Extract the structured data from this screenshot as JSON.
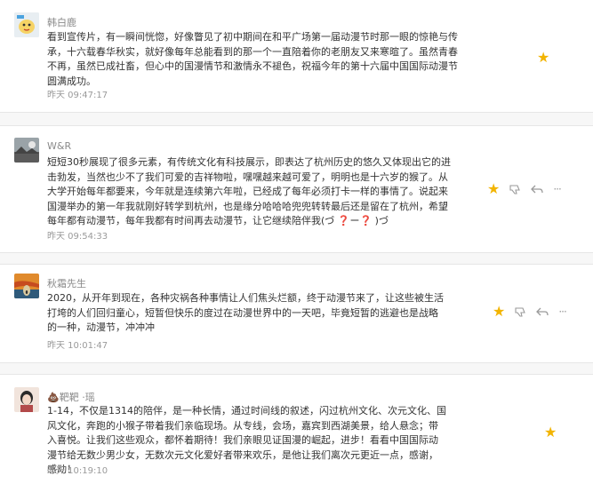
{
  "comments": [
    {
      "username": "韩白鹿",
      "text": "看到宣传片，有一瞬间恍惚，好像瞥见了初中期间在和平广场第一届动漫节时那一眼的惊艳与传承，十六载春华秋实，就好像每年总能看到的那一个一直陪着你的老朋友又来寒暄了。虽然青春不再，虽然已成社畜，但心中的国漫情节和激情永不褪色，祝福今年的第十六届中国国际动漫节圆满成功。",
      "time": "昨天 09:47:17",
      "avatar_icon": "bird-sticker-avatar"
    },
    {
      "username": "W&R",
      "text": "短短30秒展现了很多元素，有传统文化有科技展示，即表达了杭州历史的悠久又体现出它的进击勃发，当然也少不了我们可爱的吉祥物啦，嘿嘿越来越可爱了，明明也是十六岁的猴了。从大学开始每年都要来，今年就是连续第六年啦，已经成了每年必须打卡一样的事情了。说起来国漫举办的第一年我就刚好转学到杭州，也是缘分哈哈哈兜兜转转最后还是留在了杭州，希望每年都有动漫节，每年我都有时间再去动漫节，让它继续陪伴我(づ ❓ー❓ )づ",
      "time": "昨天 09:54:33",
      "avatar_icon": "landscape-avatar"
    },
    {
      "username": "秋霜先生",
      "text": "2020，从开年到现在，各种灾祸各种事情让人们焦头烂额，终于动漫节来了，让这些被生活打垮的人们回归童心，短暂但快乐的度过在动漫世界中的一天吧，毕竟短暂的逃避也是战略的一种，动漫节，冲冲冲",
      "time": "昨天 10:01:47",
      "avatar_icon": "scream-painting-avatar"
    },
    {
      "username": "💩靶靶 ·瑶",
      "text": "1-14，不仅是1314的陪伴，是一种长情，通过时间线的叙述，闪过杭州文化、次元文化、国风文化，奔跑的小猴子带着我们亲临现场。从专线，会场，嘉宾到西湖美景，给人悬念；带入喜悦。让我们这些观众，都怀着期待！我们亲眼见证国漫的崛起，进步！看看中国国际动漫节给无数少男少女，无数次元文化爱好者带来欢乐，是他让我们离次元更近一点，感谢，感动！",
      "time": "昨天 10:19:10",
      "avatar_icon": "girl-avatar"
    }
  ],
  "icons": {
    "star": "★",
    "thumb_down": "👎",
    "reply": "↩",
    "more": "···"
  },
  "colors": {
    "star": "#f2b400",
    "muted": "#9a9a9a",
    "username": "#8a8a8a"
  }
}
